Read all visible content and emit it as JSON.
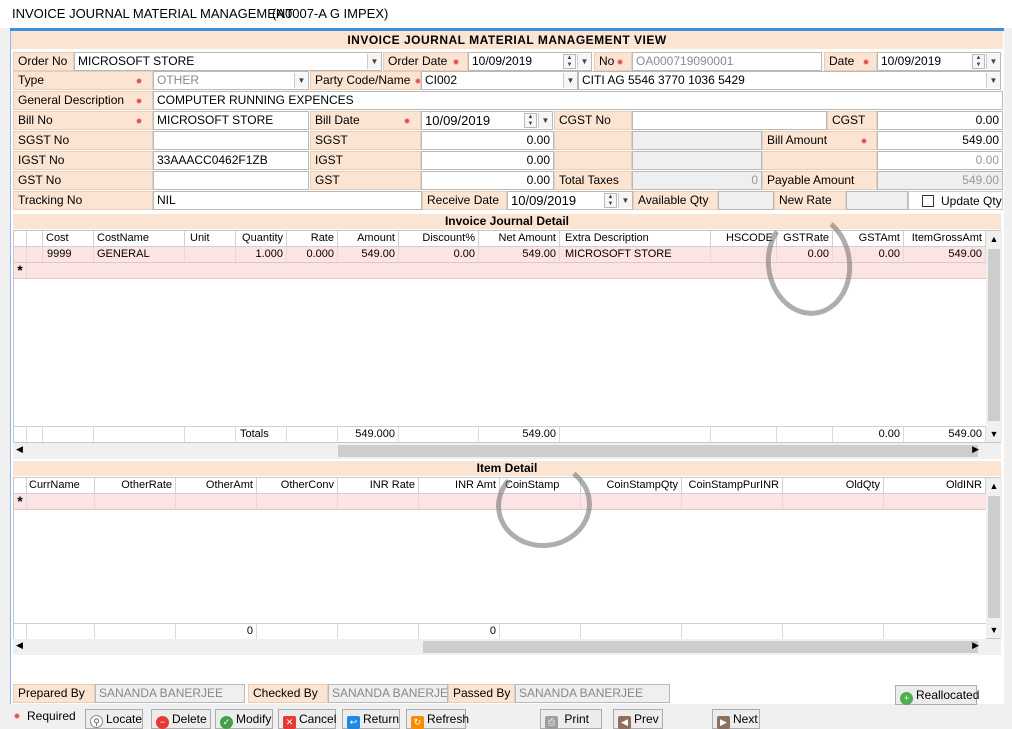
{
  "window": {
    "title": "INVOICE JOURNAL MATERIAL MANAGEMENT",
    "company": "(A0007-A G IMPEX)"
  },
  "view_title": "INVOICE JOURNAL MATERIAL MANAGEMENT VIEW",
  "form": {
    "order_no_label": "Order No",
    "order_no": "MICROSOFT STORE",
    "order_date_label": "Order Date",
    "order_date": "10/09/2019",
    "no_label": "No",
    "no": "OA000719090001",
    "date_label": "Date",
    "date": "10/09/2019",
    "type_label": "Type",
    "type": "OTHER",
    "party_label": "Party Code/Name",
    "party_code": "CI002",
    "party_name": "CITI AG 5546 3770 1036 5429",
    "gen_desc_label": "General Description",
    "gen_desc": "COMPUTER RUNNING EXPENCES",
    "bill_no_label": "Bill No",
    "bill_no": "MICROSOFT STORE",
    "bill_date_label": "Bill Date",
    "bill_date": "10/09/2019",
    "cgst_no_label": "CGST No",
    "cgst_label": "CGST",
    "cgst": "0.00",
    "sgst_no_label": "SGST No",
    "sgst_label": "SGST",
    "sgst": "0.00",
    "bill_amount_label": "Bill Amount",
    "bill_amount": "549.00",
    "igst_no_label": "IGST No",
    "igst_no": "33AAACC0462F1ZB",
    "igst_label": "IGST",
    "igst": "0.00",
    "bill_amount_2": "0.00",
    "gst_no_label": "GST No",
    "gst_label": "GST",
    "gst": "0.00",
    "total_taxes_label": "Total Taxes",
    "total_taxes": "0",
    "payable_label": "Payable Amount",
    "payable": "549.00",
    "tracking_label": "Tracking No",
    "tracking": "NIL",
    "receive_date_label": "Receive Date",
    "receive_date": "10/09/2019",
    "avail_qty_label": "Available Qty",
    "new_rate_label": "New Rate",
    "update_qty_label": "Update Qty"
  },
  "journal": {
    "title": "Invoice Journal Detail",
    "columns": [
      "Cost",
      "CostName",
      "Unit",
      "Quantity",
      "Rate",
      "Amount",
      "Discount%",
      "Net Amount",
      "Extra Description",
      "HSCODE",
      "GSTRate",
      "GSTAmt",
      "ItemGrossAmt"
    ],
    "row": [
      "9999",
      "GENERAL",
      "",
      "1.000",
      "0.000",
      "549.00",
      "0.00",
      "549.00",
      "MICROSOFT STORE",
      "",
      "0.00",
      "0.00",
      "549.00"
    ],
    "totals_label": "Totals",
    "totals_amount": "549.000",
    "totals_net": "549.00",
    "totals_gstamt": "0.00",
    "totals_gross": "549.00"
  },
  "item": {
    "title": "Item Detail",
    "columns": [
      "CurrName",
      "OtherRate",
      "OtherAmt",
      "OtherConv",
      "INR Rate",
      "INR Amt",
      "CoinStamp",
      "CoinStampQty",
      "CoinStampPurINR",
      "OldQty",
      "OldINR"
    ],
    "totals_otheramt": "0",
    "totals_inramt": "0"
  },
  "footer": {
    "prepared_label": "Prepared By",
    "prepared": "SANANDA BANERJEE",
    "checked_label": "Checked By",
    "checked": "SANANDA BANERJEE",
    "passed_label": "Passed By",
    "passed": "SANANDA BANERJEE",
    "reallocated": "Reallocated"
  },
  "buttons": {
    "required": "Required",
    "locate": "Locate",
    "delete": "Delete",
    "modify": "Modify",
    "cancel": "Cancel",
    "return": "Return",
    "refresh": "Refresh",
    "print": "Print",
    "prev": "Prev",
    "next": "Next"
  }
}
